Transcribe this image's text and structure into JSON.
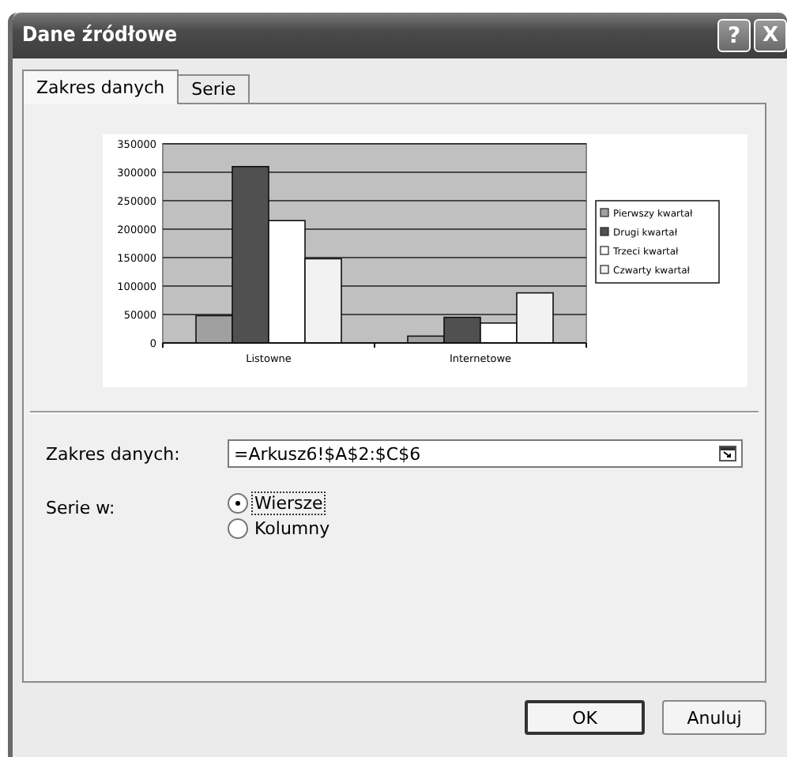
{
  "window": {
    "title": "Dane źródłowe",
    "controls": [
      {
        "kind": "help",
        "label": "?"
      },
      {
        "kind": "close",
        "label": "X"
      }
    ]
  },
  "tabs": [
    {
      "label": "Zakres danych",
      "selected": true
    },
    {
      "label": "Serie",
      "selected": false
    }
  ],
  "chart_data": {
    "type": "bar",
    "grid": true,
    "legend": true,
    "categories": [
      "Listowne",
      "Internetowe"
    ],
    "yticks": [
      0,
      50000,
      100000,
      150000,
      200000,
      250000,
      300000,
      350000
    ],
    "ylim": [
      0,
      350000
    ],
    "series": [
      {
        "name": "Pierwszy kwartał",
        "color": "#a0a0a0",
        "values": [
          48000,
          12000
        ]
      },
      {
        "name": "Drugi kwartał",
        "color": "#505050",
        "values": [
          310000,
          45000
        ]
      },
      {
        "name": "Trzeci kwartał",
        "color": "#ffffff",
        "values": [
          215000,
          35000
        ]
      },
      {
        "name": "Czwarty kwartał",
        "color": "#f2f2f2",
        "values": [
          148000,
          88000
        ]
      }
    ]
  },
  "range": {
    "label": "Zakres danych:",
    "value": "=Arkusz6!$A$2:$C$6"
  },
  "series_in": {
    "label": "Serie w:",
    "options": [
      {
        "label": "Wiersze",
        "selected": true
      },
      {
        "label": "Kolumny",
        "selected": false
      }
    ]
  },
  "buttons": [
    {
      "kind": "default",
      "label": "OK"
    },
    {
      "kind": "cancel",
      "label": "Anuluj"
    }
  ]
}
